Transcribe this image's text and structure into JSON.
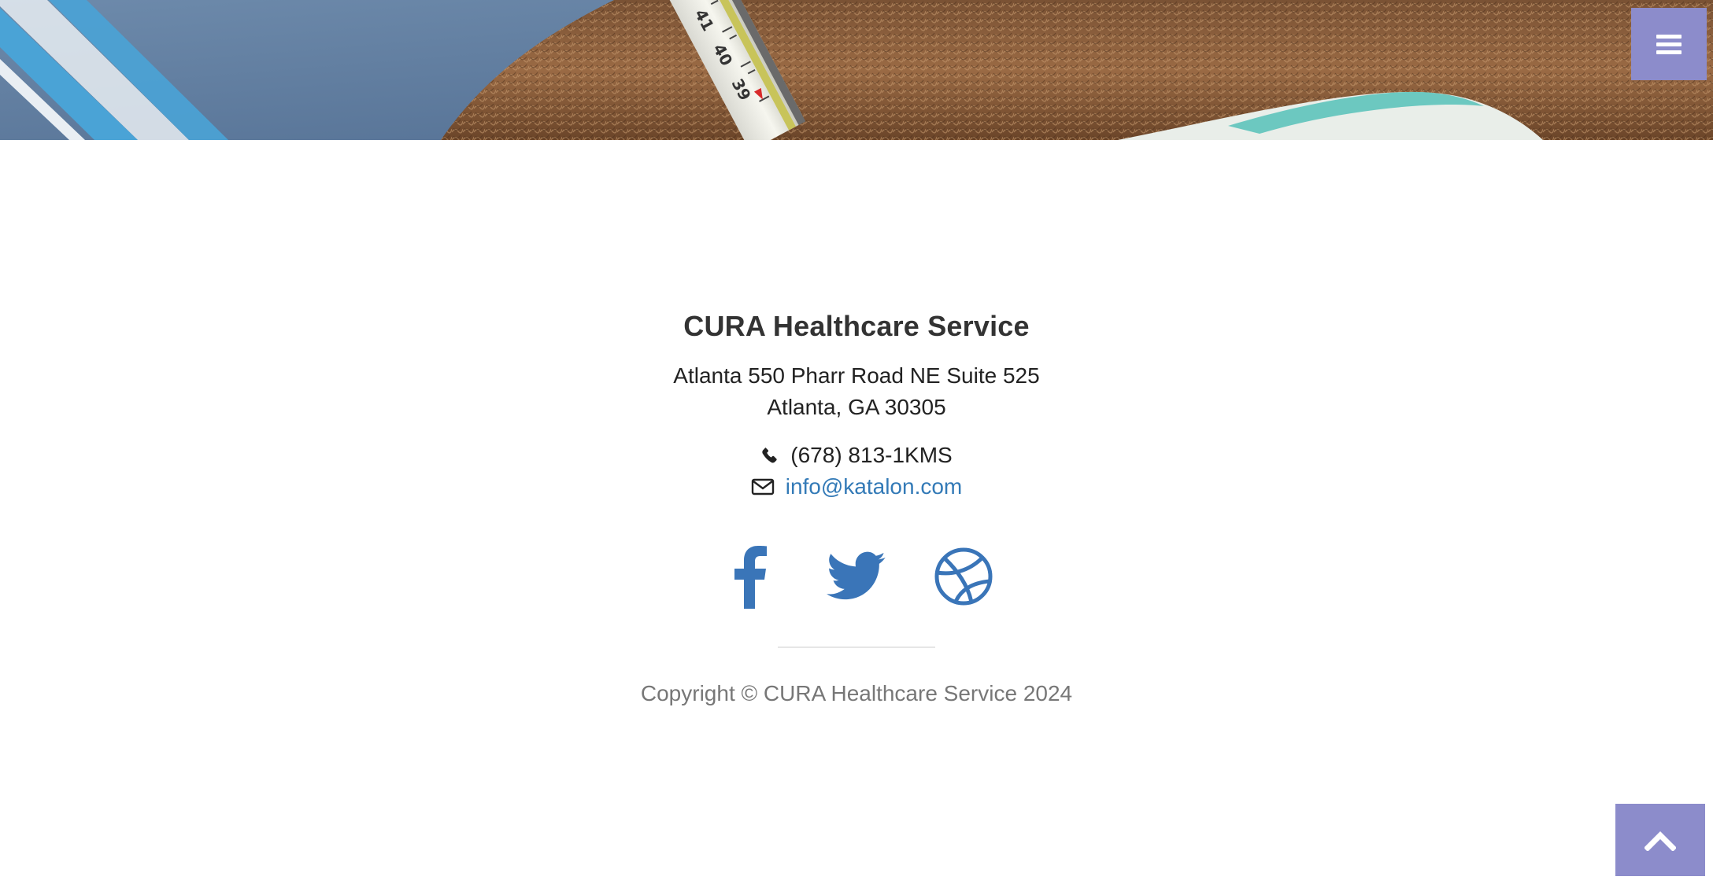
{
  "header": {
    "menu_icon": "bars-icon",
    "accent_color": "#8c8ccb"
  },
  "footer": {
    "title": "CURA Healthcare Service",
    "address_line1": "Atlanta 550 Pharr Road NE Suite 525",
    "address_line2": "Atlanta, GA 30305",
    "phone": "(678) 813-1KMS",
    "phone_icon": "phone-icon",
    "email": "info@katalon.com",
    "email_icon": "envelope-icon",
    "social": [
      {
        "name": "facebook",
        "icon": "facebook-icon"
      },
      {
        "name": "twitter",
        "icon": "twitter-icon"
      },
      {
        "name": "dribbble",
        "icon": "dribbble-icon"
      }
    ],
    "link_color": "#337ab7",
    "copyright": "Copyright © CURA Healthcare Service 2024"
  },
  "back_to_top": {
    "icon": "chevron-up-icon"
  }
}
